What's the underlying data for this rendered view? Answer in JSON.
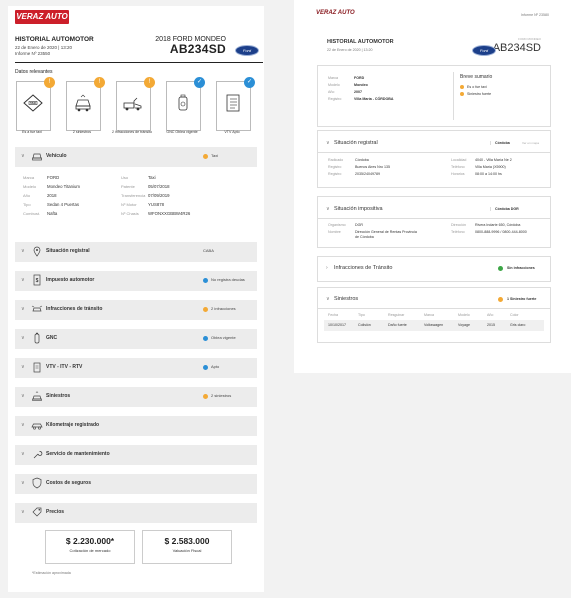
{
  "colors": {
    "brand": "#cc1f2a",
    "warn": "#f3a935",
    "ok": "#2b8fd6",
    "success": "#3ca646"
  },
  "left": {
    "logo_text": "VERAZ AUTO",
    "logo_sub": "un producto",
    "header": {
      "title": "HISTORIAL AUTOMOTOR",
      "date": "22 de Enero de 2020 | 13:20",
      "report": "Informe Nº 23550",
      "model": "2018 FORD MONDEO",
      "plate": "AB234SD",
      "brand_badge": "Ford"
    },
    "relevantes_label": "Datos relevantes",
    "cards": [
      {
        "label": "Es a fue taxi",
        "icon": "taxi-icon",
        "status": "warn"
      },
      {
        "label": "2 siniestros",
        "icon": "crash-icon",
        "status": "warn"
      },
      {
        "label": "2 infracciones de tránsito",
        "icon": "tow-truck-icon",
        "status": "warn"
      },
      {
        "label": "GNC Oblea vigente",
        "icon": "gas-tank-icon",
        "status": "ok"
      },
      {
        "label": "VTV Apto",
        "icon": "checklist-icon",
        "status": "ok"
      }
    ],
    "sections": [
      {
        "title": "Vehículo",
        "status": "Taxi",
        "dot": "warn",
        "icon": "car-icon"
      },
      {
        "title": "Situación registral",
        "status": "CABA",
        "dot": "",
        "icon": "location-pin-icon"
      },
      {
        "title": "Impuesto automotor",
        "status": "No registra deudas",
        "dot": "ok",
        "icon": "tax-icon"
      },
      {
        "title": "Infracciones de tránsito",
        "status": "2 infracciones",
        "dot": "warn",
        "icon": "infraction-car-icon"
      },
      {
        "title": "GNC",
        "status": "Oblea vigente",
        "dot": "ok",
        "icon": "gas-cylinder-icon"
      },
      {
        "title": "VTV - ITV - RTV",
        "status": "Apto",
        "dot": "ok",
        "icon": "clipboard-icon"
      },
      {
        "title": "Siniestros",
        "status": "2 siniestros",
        "dot": "warn",
        "icon": "collision-icon"
      },
      {
        "title": "Kilometraje registrado",
        "status": "",
        "dot": "",
        "icon": "odometer-car-icon"
      },
      {
        "title": "Servicio de mantenimiento",
        "status": "",
        "dot": "",
        "icon": "wrench-icon"
      },
      {
        "title": "Costos de seguros",
        "status": "",
        "dot": "",
        "icon": "shield-icon"
      },
      {
        "title": "Precios",
        "status": "",
        "dot": "",
        "icon": "price-tag-icon"
      }
    ],
    "vehiculo": {
      "rows": [
        {
          "l1": "Marca",
          "v1": "FORD",
          "l2": "Uso",
          "v2": "Taxi"
        },
        {
          "l1": "Modelo",
          "v1": "Mondeo Titanium",
          "l2": "Patente",
          "v2": "05/07/2018"
        },
        {
          "l1": "Año",
          "v1": "2018",
          "l2": "Transferencia",
          "v2": "07/09/2019"
        },
        {
          "l1": "Tipo",
          "v1": "Sedan 4 Puertas",
          "l2": "Nº Motor",
          "v2": "YUS878"
        },
        {
          "l1": "Combust.",
          "v1": "Nafta",
          "l2": "Nº Chasis",
          "v2": "WFONXXGBBW4R26"
        }
      ]
    },
    "precios": {
      "market_value": "$ 2.230.000*",
      "market_label": "Cotización de mercado",
      "fiscal_value": "$ 2.583.000",
      "fiscal_label": "Valuación Fiscal",
      "note": "*Estimación aproximada"
    }
  },
  "right": {
    "logo_text": "VERAZ AUTO",
    "report": "Informe Nº 23580",
    "header": {
      "title": "HISTORIAL AUTOMOTOR",
      "date": "22 de Enero de 2020 | 13:20",
      "model": "FORD MONDEO",
      "plate": "AB234SD",
      "brand_badge": "Ford"
    },
    "summary": {
      "rows": [
        {
          "label": "Marca",
          "value": "FORD"
        },
        {
          "label": "Modelo",
          "value": "Mondeo"
        },
        {
          "label": "Año",
          "value": "2007"
        },
        {
          "label": "Registro",
          "value": "Villa María - CÓRDOBA"
        }
      ],
      "title": "Breve sumario",
      "items": [
        "Es o fue taxi",
        "Siniestro fuerte"
      ]
    },
    "registral": {
      "title": "Situación registral",
      "status": "Córdoba",
      "link": "Ver en mapa",
      "rows": [
        {
          "l1": "Radicado",
          "v1": "Córdoba",
          "l2": "Localidad",
          "v2": "4040 - Villa María Ne 2"
        },
        {
          "l1": "Registro",
          "v1": "Buenos Aires Nro 135",
          "l2": "Teléfono",
          "v2": "Villa María (X5900)"
        },
        {
          "l1": "Registro",
          "v1": "2035/24049789",
          "l2": "Horarios",
          "v2": "08:00 a 14:00 hs"
        }
      ]
    },
    "impositiva": {
      "title": "Situación impositiva",
      "status": "Córdoba DGR",
      "rows": [
        {
          "l1": "Organismo",
          "v1": "DGR",
          "l2": "Dirección",
          "v2": "Rivera Indarte 650, Córdoba"
        },
        {
          "l1": "Nombre",
          "v1": "Dirección General de Rentas Provincia de Córdoba",
          "l2": "Teléfono",
          "v2": "0800-888-9996 / 0800-444-8000"
        }
      ]
    },
    "infracciones": {
      "title": "Infracciones de Tránsito",
      "status": "Sin infracciones"
    },
    "siniestros": {
      "title": "Siniestros",
      "status": "1 Siniestro fuerte",
      "headers": [
        "Fecha",
        "Tipo",
        "Resguinar",
        "Marca",
        "Modelo",
        "Año",
        "Color"
      ],
      "row": [
        "10/10/2017",
        "Colisión",
        "Daño fuerte",
        "Volkswagen",
        "Voyage",
        "2015",
        "Gris claro"
      ]
    }
  }
}
